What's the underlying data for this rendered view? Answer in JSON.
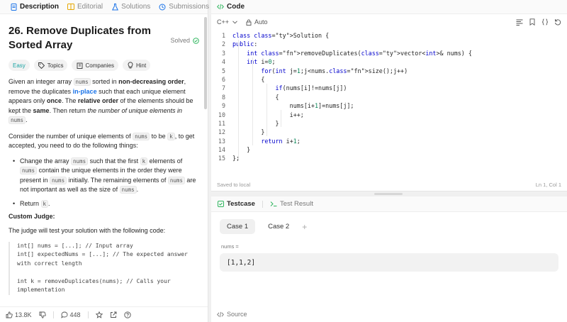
{
  "left_tabs": [
    {
      "label": "Description"
    },
    {
      "label": "Editorial"
    },
    {
      "label": "Solutions"
    },
    {
      "label": "Submissions"
    }
  ],
  "problem": {
    "title": "26. Remove Duplicates from Sorted Array",
    "status": "Solved",
    "chips": {
      "difficulty": "Easy",
      "topics": "Topics",
      "companies": "Companies",
      "hint": "Hint"
    },
    "p1_a": "Given an integer array ",
    "p1_code": "nums",
    "p1_b": " sorted in ",
    "p1_bold1": "non-decreasing order",
    "p1_c": ", remove the duplicates ",
    "p1_link": "in-place",
    "p1_d": " such that each unique element appears only ",
    "p1_bold2": "once",
    "p1_e": ". The ",
    "p1_bold3": "relative order",
    "p1_f": " of the elements should be kept the ",
    "p1_bold4": "same",
    "p1_g": ". Then return ",
    "p1_ital": "the number of unique elements in",
    "p1_code2": "nums",
    "p1_h": ".",
    "p2_a": "Consider the number of unique elements of ",
    "p2_code": "nums",
    "p2_b": " to be ",
    "p2_code2": "k",
    "p2_c": ", to get accepted, you need to do the following things:",
    "li1_a": "Change the array ",
    "li1_code": "nums",
    "li1_b": " such that the first ",
    "li1_code2": "k",
    "li1_c": " elements of ",
    "li1_code3": "nums",
    "li1_d": " contain the unique elements in the order they were present in ",
    "li1_code4": "nums",
    "li1_e": " initially. The remaining elements of ",
    "li1_code5": "nums",
    "li1_f": " are not important as well as the size of ",
    "li1_code6": "nums",
    "li1_g": ".",
    "li2_a": "Return ",
    "li2_code": "k",
    "li2_b": ".",
    "judge_title": "Custom Judge:",
    "judge_text": "The judge will test your solution with the following code:",
    "judge_code": "int[] nums = [...]; // Input array\nint[] expectedNums = [...]; // The expected answer with correct length\n\nint k = removeDuplicates(nums); // Calls your implementation"
  },
  "bottom_bar": {
    "likes": "13.8K",
    "comments": "448"
  },
  "code_panel": {
    "title": "Code",
    "language": "C++",
    "mode": "Auto",
    "lines": [
      {
        "n": "1",
        "text": "class Solution {"
      },
      {
        "n": "2",
        "text": "public:"
      },
      {
        "n": "3",
        "text": "    int removeDuplicates(vector<int>& nums) {"
      },
      {
        "n": "4",
        "text": "    int i=0;"
      },
      {
        "n": "5",
        "text": "        for(int j=1;j<nums.size();j++)"
      },
      {
        "n": "6",
        "text": "        {"
      },
      {
        "n": "7",
        "text": "            if(nums[i]!=nums[j])"
      },
      {
        "n": "8",
        "text": "            {"
      },
      {
        "n": "9",
        "text": "                nums[i+1]=nums[j];"
      },
      {
        "n": "10",
        "text": "                i++;"
      },
      {
        "n": "11",
        "text": "            }"
      },
      {
        "n": "12",
        "text": "        }"
      },
      {
        "n": "13",
        "text": "        return i+1;"
      },
      {
        "n": "14",
        "text": "    }"
      },
      {
        "n": "15",
        "text": "};"
      }
    ],
    "saved": "Saved to local",
    "cursor": "Ln 1, Col 1"
  },
  "test_panel": {
    "tab_testcase": "Testcase",
    "tab_result": "Test Result",
    "cases": [
      "Case 1",
      "Case 2"
    ],
    "var_label": "nums =",
    "value": "[1,1,2]",
    "source_label": "Source"
  },
  "colors": {
    "accent_blue": "#1a73e8",
    "easy_teal": "#1aa3a3",
    "solved_green": "#2db55d"
  }
}
